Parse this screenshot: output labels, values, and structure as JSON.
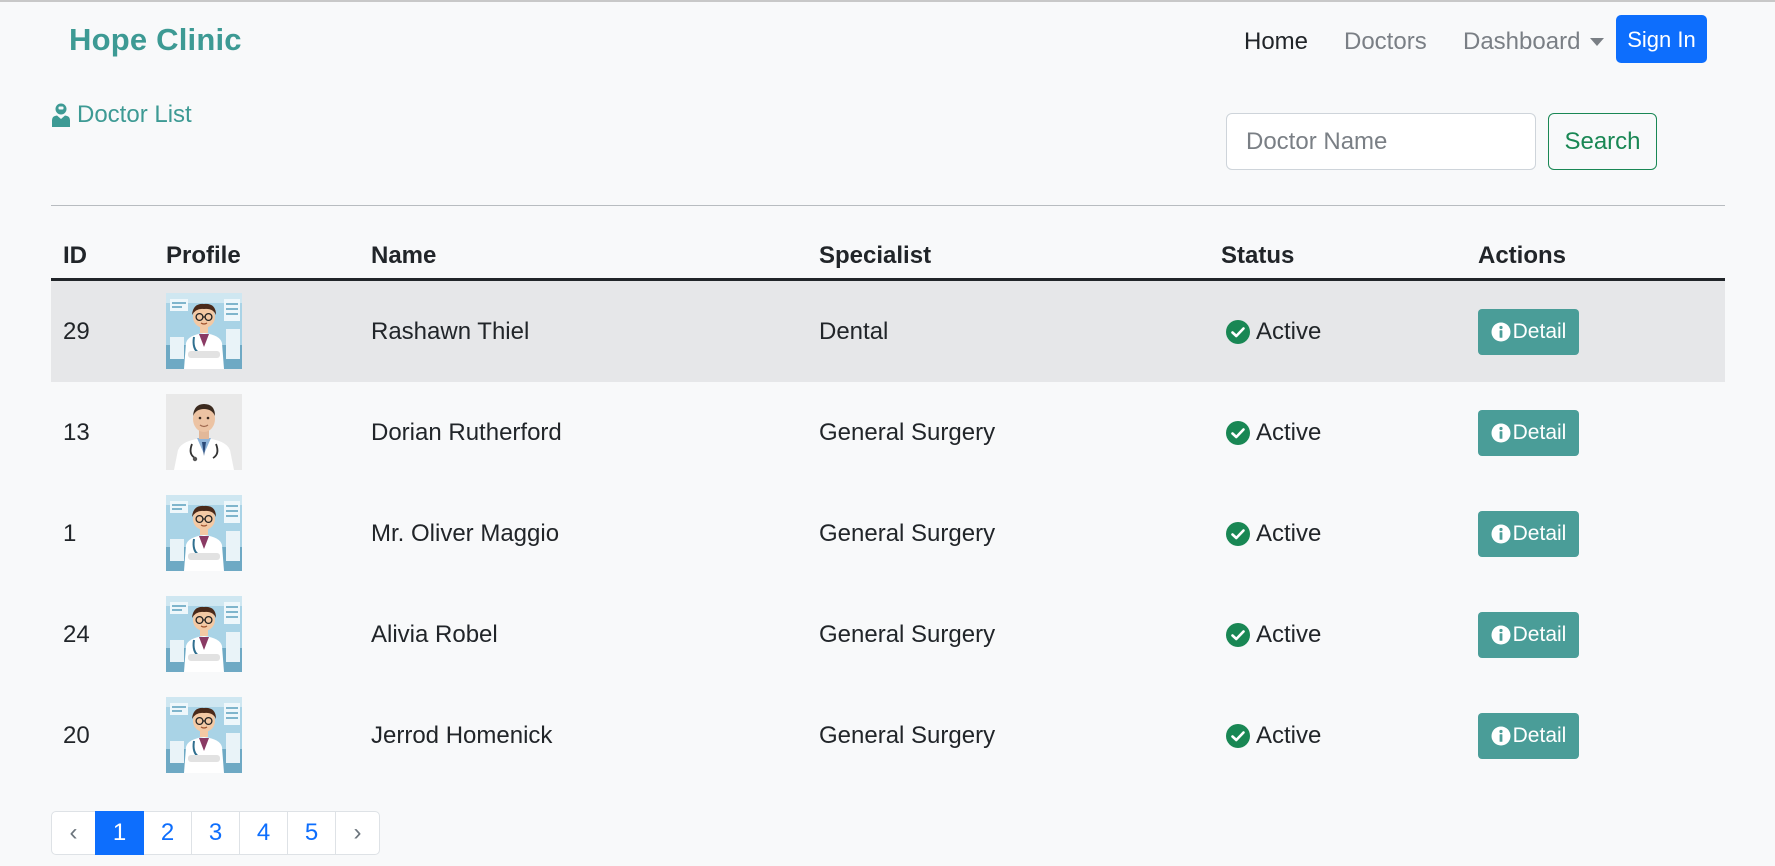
{
  "navbar": {
    "brand": "Hope Clinic",
    "links": {
      "home": "Home",
      "doctors": "Doctors",
      "dashboard": "Dashboard"
    },
    "signin_label": "Sign In"
  },
  "page": {
    "title": "Doctor List",
    "title_icon": "doctor-icon"
  },
  "search": {
    "placeholder": "Doctor Name",
    "value": "",
    "button_label": "Search"
  },
  "table": {
    "columns": {
      "id": "ID",
      "profile": "Profile",
      "name": "Name",
      "specialist": "Specialist",
      "status": "Status",
      "actions": "Actions"
    },
    "rows": [
      {
        "id": "29",
        "avatar": "cartoon-doctor",
        "name": "Rashawn Thiel",
        "specialist": "Dental",
        "status": "Active",
        "action": "Detail"
      },
      {
        "id": "13",
        "avatar": "photo-doctor",
        "name": "Dorian Rutherford",
        "specialist": "General Surgery",
        "status": "Active",
        "action": "Detail"
      },
      {
        "id": "1",
        "avatar": "cartoon-doctor",
        "name": "Mr. Oliver Maggio",
        "specialist": "General Surgery",
        "status": "Active",
        "action": "Detail"
      },
      {
        "id": "24",
        "avatar": "cartoon-doctor",
        "name": "Alivia Robel",
        "specialist": "General Surgery",
        "status": "Active",
        "action": "Detail"
      },
      {
        "id": "20",
        "avatar": "cartoon-doctor",
        "name": "Jerrod Homenick",
        "specialist": "General Surgery",
        "status": "Active",
        "action": "Detail"
      }
    ]
  },
  "pagination": {
    "prev": "‹",
    "pages": [
      "1",
      "2",
      "3",
      "4",
      "5"
    ],
    "current": "1",
    "next": "›"
  },
  "colors": {
    "brand": "#3d9a94",
    "primary": "#0d6efd",
    "success": "#198754",
    "detail_button": "#4a9d98",
    "row_hover": "#e6e7e9"
  }
}
